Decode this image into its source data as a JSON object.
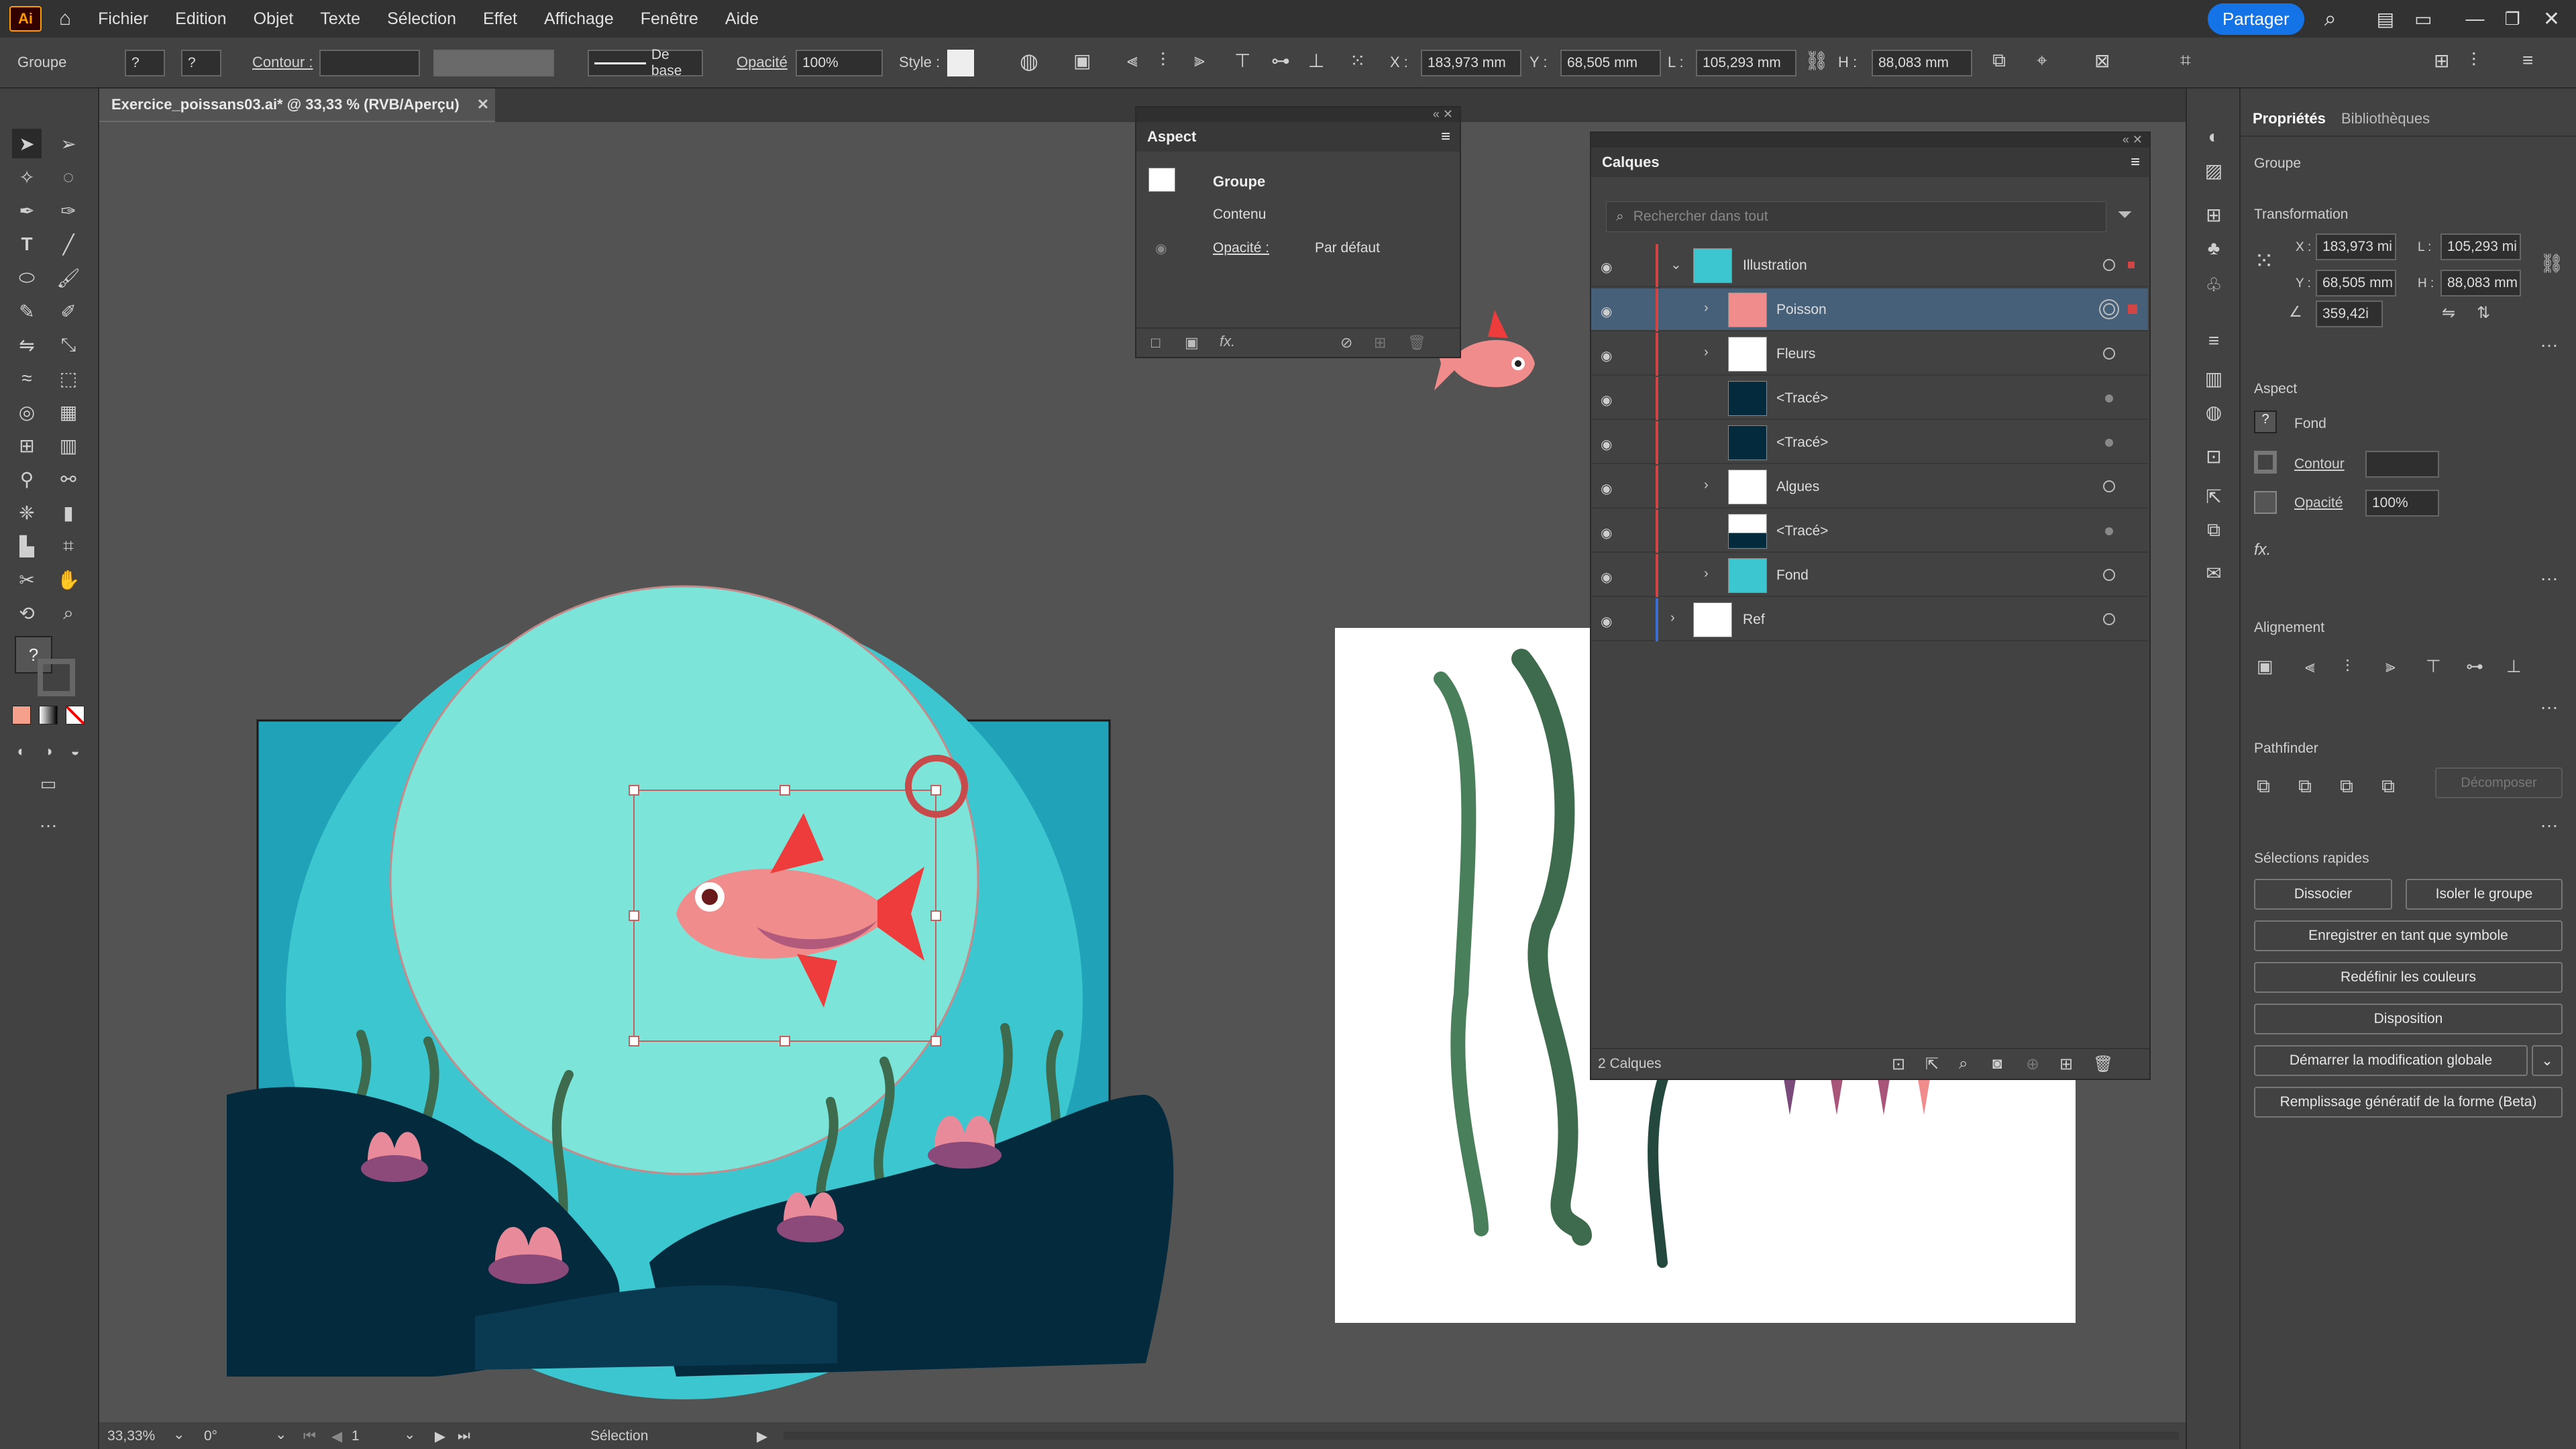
{
  "menubar": {
    "logo": "Ai",
    "items": [
      "Fichier",
      "Edition",
      "Objet",
      "Texte",
      "Sélection",
      "Effet",
      "Affichage",
      "Fenêtre",
      "Aide"
    ],
    "share": "Partager"
  },
  "control": {
    "selection_type": "Groupe",
    "contour_label": "Contour :",
    "stroke_profile": "De base",
    "opacity_label": "Opacité",
    "opacity": "100%",
    "style_label": "Style :",
    "x_label": "X :",
    "x": "183,973 mm",
    "y_label": "Y :",
    "y": "68,505 mm",
    "w_label": "L :",
    "w": "105,293 mm",
    "h_label": "H :",
    "h": "88,083 mm"
  },
  "document": {
    "tab_title": "Exercice_poissans03.ai* @ 33,33 % (RVB/Aperçu)"
  },
  "status": {
    "zoom": "33,33%",
    "rotation": "0°",
    "artboard": "1",
    "tool": "Sélection"
  },
  "aspect_panel": {
    "title": "Aspect",
    "group_label": "Groupe",
    "content_label": "Contenu",
    "opacity_label": "Opacité :",
    "opacity_value": "Par défaut"
  },
  "layers_panel": {
    "title": "Calques",
    "search_placeholder": "Rechercher dans tout",
    "rows": [
      {
        "name": "Illustration",
        "indent": 0
      },
      {
        "name": "Poisson",
        "indent": 1
      },
      {
        "name": "Fleurs",
        "indent": 1
      },
      {
        "name": "<Tracé>",
        "indent": 1
      },
      {
        "name": "<Tracé>",
        "indent": 1
      },
      {
        "name": "Algues",
        "indent": 1
      },
      {
        "name": "<Tracé>",
        "indent": 1
      },
      {
        "name": "Fond",
        "indent": 1
      },
      {
        "name": "Ref",
        "indent": 0
      }
    ],
    "footer": "2 Calques"
  },
  "properties_panel": {
    "tabs": [
      "Propriétés",
      "Bibliothèques"
    ],
    "selection_type": "Groupe",
    "transform_title": "Transformation",
    "x_label": "X :",
    "x": "183,973 mi",
    "y_label": "Y :",
    "y": "68,505 mm",
    "w_label": "L :",
    "w": "105,293 mi",
    "h_label": "H :",
    "h": "88,083 mm",
    "angle": "359,42i",
    "aspect_title": "Aspect",
    "fill_label": "Fond",
    "stroke_label": "Contour",
    "opacity_label": "Opacité",
    "opacity": "100%",
    "fx": "fx.",
    "align_title": "Alignement",
    "pathfinder_title": "Pathfinder",
    "decompose": "Décomposer",
    "quick_title": "Sélections rapides",
    "btn_ungroup": "Dissocier",
    "btn_isolate": "Isoler le groupe",
    "btn_symbol": "Enregistrer en tant que symbole",
    "btn_recolor": "Redéfinir les couleurs",
    "btn_arrange": "Disposition",
    "btn_global": "Démarrer la modification globale",
    "btn_genfill": "Remplissage génératif de la forme (Beta)"
  },
  "colors": {
    "canvas": "#535353",
    "water_light": "#7de4d9",
    "water_mid": "#3cc6cf",
    "background_rect": "#20a2b8",
    "rocks": "#042a3e",
    "fish_body": "#f08c8c",
    "fin": "#ee3b3b",
    "seaweed": "#3e6b4e",
    "selected_layer": "#46607a",
    "accent": "#1473e6"
  }
}
